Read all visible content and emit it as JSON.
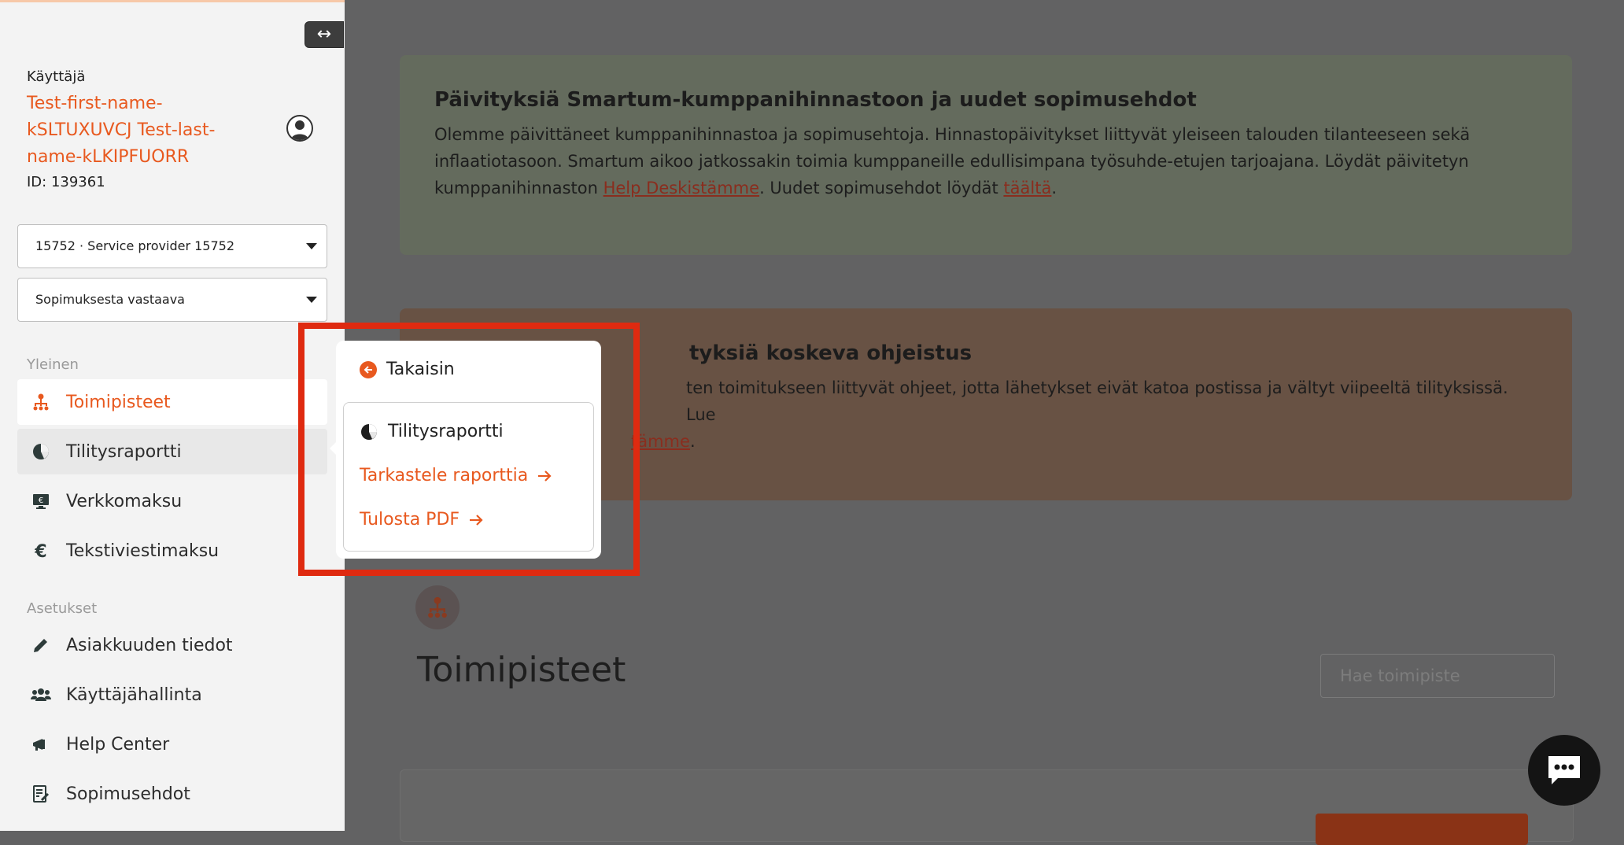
{
  "sidebar": {
    "collapse_icon": "↔",
    "user_label": "Käyttäjä",
    "user_name": "Test-first-name-kSLTUXUVCJ Test-last-name-kLKIPFUORR",
    "user_id": "ID: 139361",
    "provider_select": "15752 · Service provider 15752",
    "role_select": "Sopimuksesta vastaava",
    "section_general": "Yleinen",
    "section_settings": "Asetukset",
    "items": [
      {
        "label": "Toimipisteet",
        "icon": "org-chart-icon"
      },
      {
        "label": "Tilitysraportti",
        "icon": "pie-chart-icon"
      },
      {
        "label": "Verkkomaksu",
        "icon": "monitor-euro-icon"
      },
      {
        "label": "Tekstiviestimaksu",
        "icon": "euro-icon"
      },
      {
        "label": "Asiakkuuden tiedot",
        "icon": "pencil-icon"
      },
      {
        "label": "Käyttäjähallinta",
        "icon": "users-icon"
      },
      {
        "label": "Help Center",
        "icon": "megaphone-icon"
      },
      {
        "label": "Sopimusehdot",
        "icon": "document-edit-icon"
      }
    ]
  },
  "main": {
    "notice_updates": {
      "title": "Päivityksiä Smartum-kumppanihinnastoon ja uudet sopimusehdot",
      "text_1": "Olemme päivittäneet kumppanihinnastoa ja sopimusehtoja. Hinnastopäivitykset liittyvät yleiseen talouden tilanteeseen sekä inflaatiotasoon. Smartum aikoo jatkossakin toimia kumppaneille edullisimpana työsuhde-etujen tarjoajana. Löydät päivitetyn kumppanihinnaston ",
      "link_1": "Help Deskistämme",
      "text_2": ". Uudet sopimusehdot löydät ",
      "link_2": "täältä",
      "text_3": "."
    },
    "notice_shipping": {
      "title": "tyksiä koskeva ohjeistus",
      "text_1": "ten toimitukseen liittyvät ohjeet, jotta lähetykset eivät katoa postissa ja vältyt viipeeltä tilityksissä. Lue",
      "link_1": "tämme",
      "text_2": "."
    },
    "page_title": "Toimipisteet",
    "search_placeholder": "Hae toimipiste"
  },
  "popup": {
    "back_label": "Takaisin",
    "title": "Tilitysraportti",
    "view_report": "Tarkastele raporttia",
    "print_pdf": "Tulosta PDF"
  },
  "colors": {
    "accent": "#e8591f",
    "highlight": "#df2a10",
    "overlay": "#626263"
  }
}
